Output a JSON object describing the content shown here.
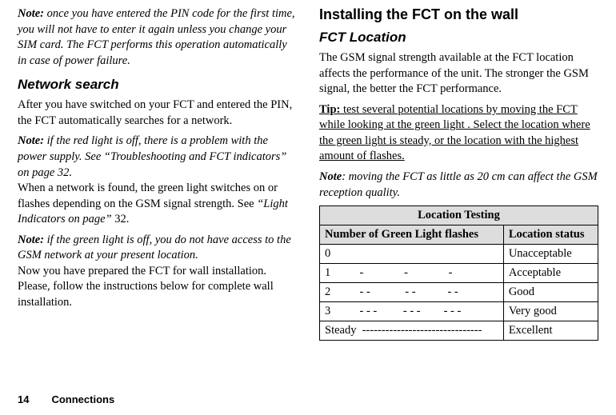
{
  "left": {
    "note1": "once you have entered the PIN code for the first time, you will not have to enter it again unless you change your SIM card. The FCT performs this operation automatically in case of power failure.",
    "h2_network": "Network search",
    "p1": "After you have switched on your FCT and entered the PIN, the FCT automatically searches for a network.",
    "note2": "if the red light is off, there is a problem with the power supply. See “Troubleshooting and FCT indicators” on page 32.",
    "p2a": "When a network is found, the green light switches on or flashes depending on the GSM signal strength. See ",
    "p2b": "“Light Indicators on page”",
    "p2c": " 32.",
    "note3": "if the green light is off, you do not have access to the GSM network at your present location.",
    "p3": "Now you have prepared the FCT for wall installation. Please, follow the instructions below for complete wall installation."
  },
  "right": {
    "h1": "Installing the FCT on the wall",
    "h2": "FCT Location",
    "p1": "The GSM signal strength available at the FCT location affects the performance of the unit. The stronger the GSM signal, the better the FCT performance.",
    "tip_label": "Tip:",
    "tip_text": " test several potential locations by moving the FCT while looking at the green light . Select the location where the green light is steady, or the location with the highest amount of flashes.",
    "note4": ": moving the FCT as little as 20 cm can affect the GSM reception quality.",
    "table": {
      "title": "Location Testing",
      "col1": "Number of Green Light flashes",
      "col2": "Location status",
      "rows": [
        {
          "flashes": "0",
          "status": "Unacceptable"
        },
        {
          "flashes": "1          -              -              -",
          "status": "Acceptable"
        },
        {
          "flashes": "2          - -            - -           - -",
          "status": "Good"
        },
        {
          "flashes": "3          - - -         - - -        - - -",
          "status": "Very good"
        },
        {
          "flashes": "Steady  -------------------------------",
          "status": "Excellent"
        }
      ]
    }
  },
  "footer": {
    "page": "14",
    "section": "Connections"
  },
  "labels": {
    "note": "Note:",
    "note_plain": "Note"
  }
}
